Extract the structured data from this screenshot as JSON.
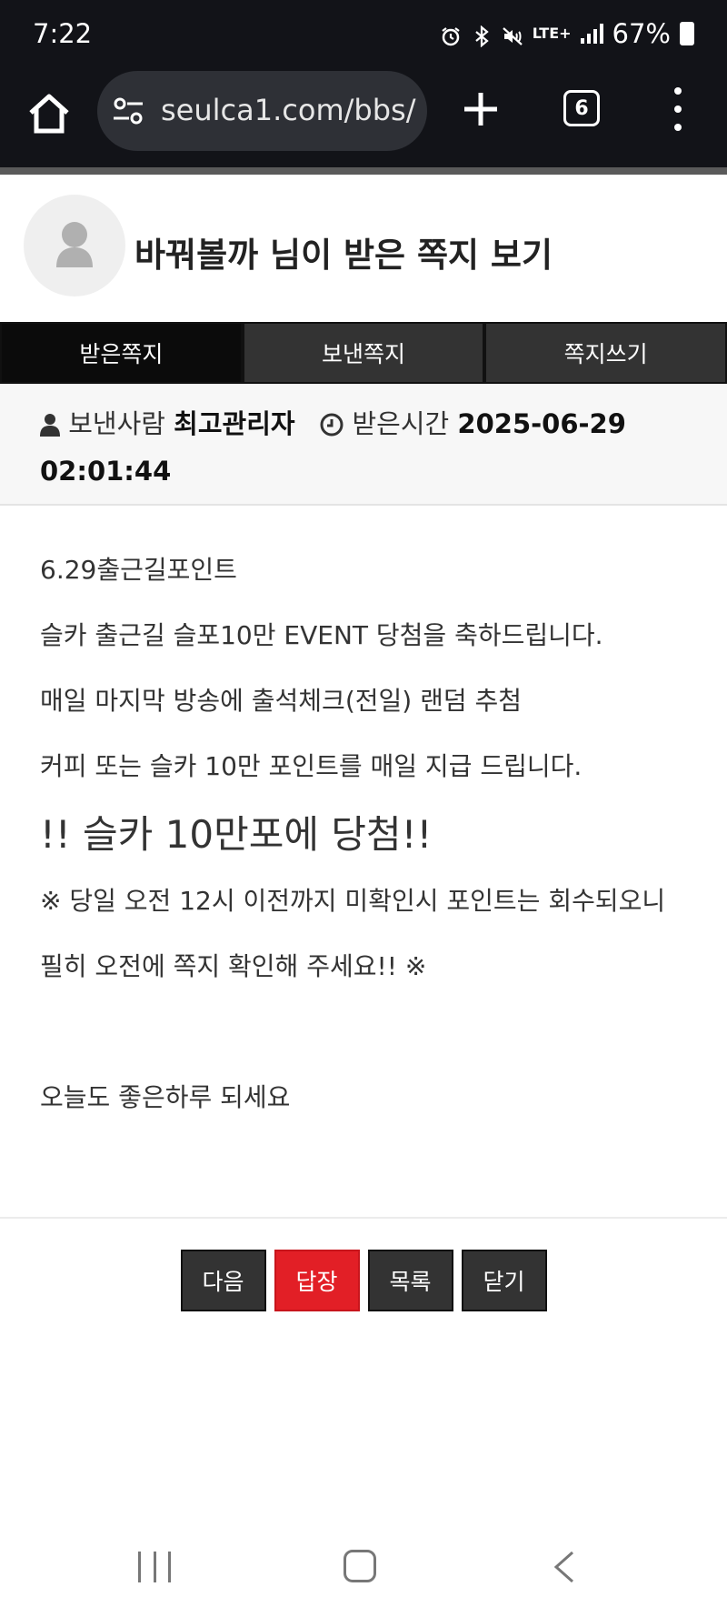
{
  "status_bar": {
    "time": "7:22",
    "network": "LTE+",
    "battery": "67%",
    "icons": [
      "alarm-icon",
      "bluetooth-icon",
      "mute-icon",
      "signal-icon",
      "battery-icon"
    ]
  },
  "browser": {
    "url": "seulca1.com/bbs/",
    "tab_count": "6"
  },
  "header": {
    "title": "바꿔볼까 님이 받은 쪽지 보기"
  },
  "tabs": [
    {
      "label": "받은쪽지",
      "active": true
    },
    {
      "label": "보낸쪽지",
      "active": false
    },
    {
      "label": "쪽지쓰기",
      "active": false
    }
  ],
  "meta": {
    "sender_label": "보낸사람",
    "sender": "최고관리자",
    "received_label": "받은시간",
    "received_at": "2025-06-29 02:01:44"
  },
  "message": {
    "lines": [
      "6.29출근길포인트",
      "슬카 출근길 슬포10만 EVENT 당첨을 축하드립니다.",
      "매일 마지막 방송에 출석체크(전일) 랜덤 추첨",
      "커피 또는 슬카 10만 포인트를 매일 지급 드립니다."
    ],
    "highlight": "!! 슬카 10만포에 당첨!!",
    "notice": "※ 당일 오전 12시 이전까지 미확인시 포인트는 회수되오니",
    "notice2": "필히 오전에 쪽지 확인해 주세요!! ※",
    "closing": "오늘도 좋은하루 되세요"
  },
  "actions": {
    "next": "다음",
    "reply": "답장",
    "list": "목록",
    "close": "닫기"
  },
  "colors": {
    "status_bg": "#121318",
    "url_pill": "#2e3036",
    "tab_active": "#0b0b0b",
    "tab_inactive": "#333333",
    "reply_red": "#e21f26"
  }
}
